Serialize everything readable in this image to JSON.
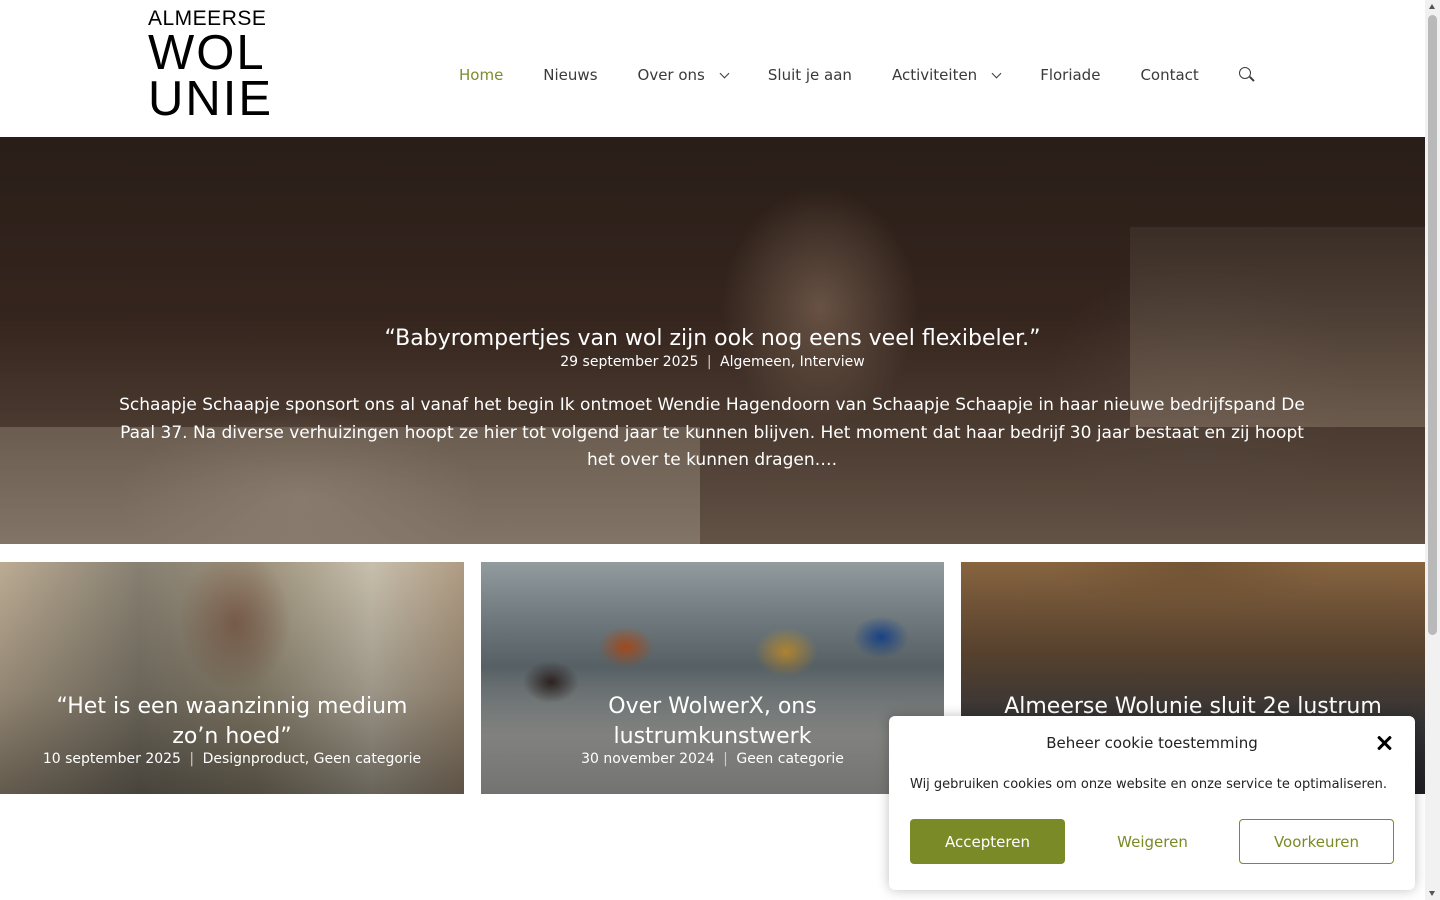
{
  "logo": {
    "line1": "ALMEERSE",
    "line2": "WOL",
    "line3": "UNIE"
  },
  "nav": {
    "items": [
      {
        "label": "Home"
      },
      {
        "label": "Nieuws"
      },
      {
        "label": "Over ons"
      },
      {
        "label": "Sluit je aan"
      },
      {
        "label": "Activiteiten"
      },
      {
        "label": "Floriade"
      },
      {
        "label": "Contact"
      }
    ],
    "active_color": "#7b8c2b"
  },
  "hero": {
    "title": "“Babyrompertjes van wol zijn ook nog eens veel flexibeler.”",
    "date": "29 september 2025",
    "separator": "|",
    "categories": "Algemeen, Interview",
    "excerpt": "Schaapje Schaapje sponsort ons al vanaf het begin Ik ontmoet Wendie Hagendoorn van Schaapje Schaapje in haar nieuwe bedrijfspand De Paal 37. Na diverse verhuizingen hoopt ze hier tot volgend jaar te kunnen blijven. Het moment dat haar bedrijf 30 jaar bestaat en zij hoopt het over te kunnen dragen…."
  },
  "posts": [
    {
      "title": "“Het is een waanzinnig medium zo’n hoed”",
      "date": "10 september 2025",
      "separator": "|",
      "categories": "Designproduct, Geen categorie"
    },
    {
      "title": "Over WolwerX, ons lustrumkunstwerk",
      "date": "30 november 2024",
      "separator": "|",
      "categories": "Geen categorie"
    },
    {
      "title": "Almeerse Wolunie sluit 2e lustrum"
    }
  ],
  "cookie": {
    "title": "Beheer cookie toestemming",
    "text": "Wij gebruiken cookies om onze website en onze service te optimaliseren.",
    "accept": "Accepteren",
    "deny": "Weigeren",
    "preferences": "Voorkeuren",
    "accent_color": "#7a8a26"
  }
}
